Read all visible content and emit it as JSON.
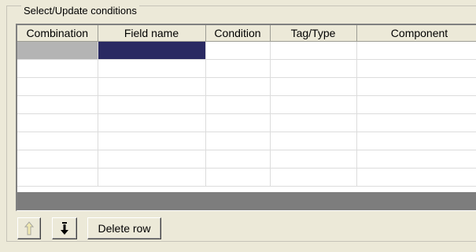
{
  "group": {
    "title": "Select/Update conditions"
  },
  "table": {
    "columns": [
      "Combination",
      "Field name",
      "Condition",
      "Tag/Type",
      "Component"
    ],
    "rows": [
      [
        "",
        "",
        "",
        "",
        ""
      ],
      [
        "",
        "",
        "",
        "",
        ""
      ],
      [
        "",
        "",
        "",
        "",
        ""
      ],
      [
        "",
        "",
        "",
        "",
        ""
      ],
      [
        "",
        "",
        "",
        "",
        ""
      ],
      [
        "",
        "",
        "",
        "",
        ""
      ],
      [
        "",
        "",
        "",
        "",
        ""
      ],
      [
        "",
        "",
        "",
        "",
        ""
      ]
    ]
  },
  "toolbar": {
    "move_up_icon": "arrow-up-icon",
    "move_down_icon": "arrow-down-icon",
    "delete_label": "Delete row"
  },
  "colors": {
    "selection_dark": "#2a2a62",
    "selection_gray": "#b4b4b4",
    "footer": "#7d7d7d"
  }
}
